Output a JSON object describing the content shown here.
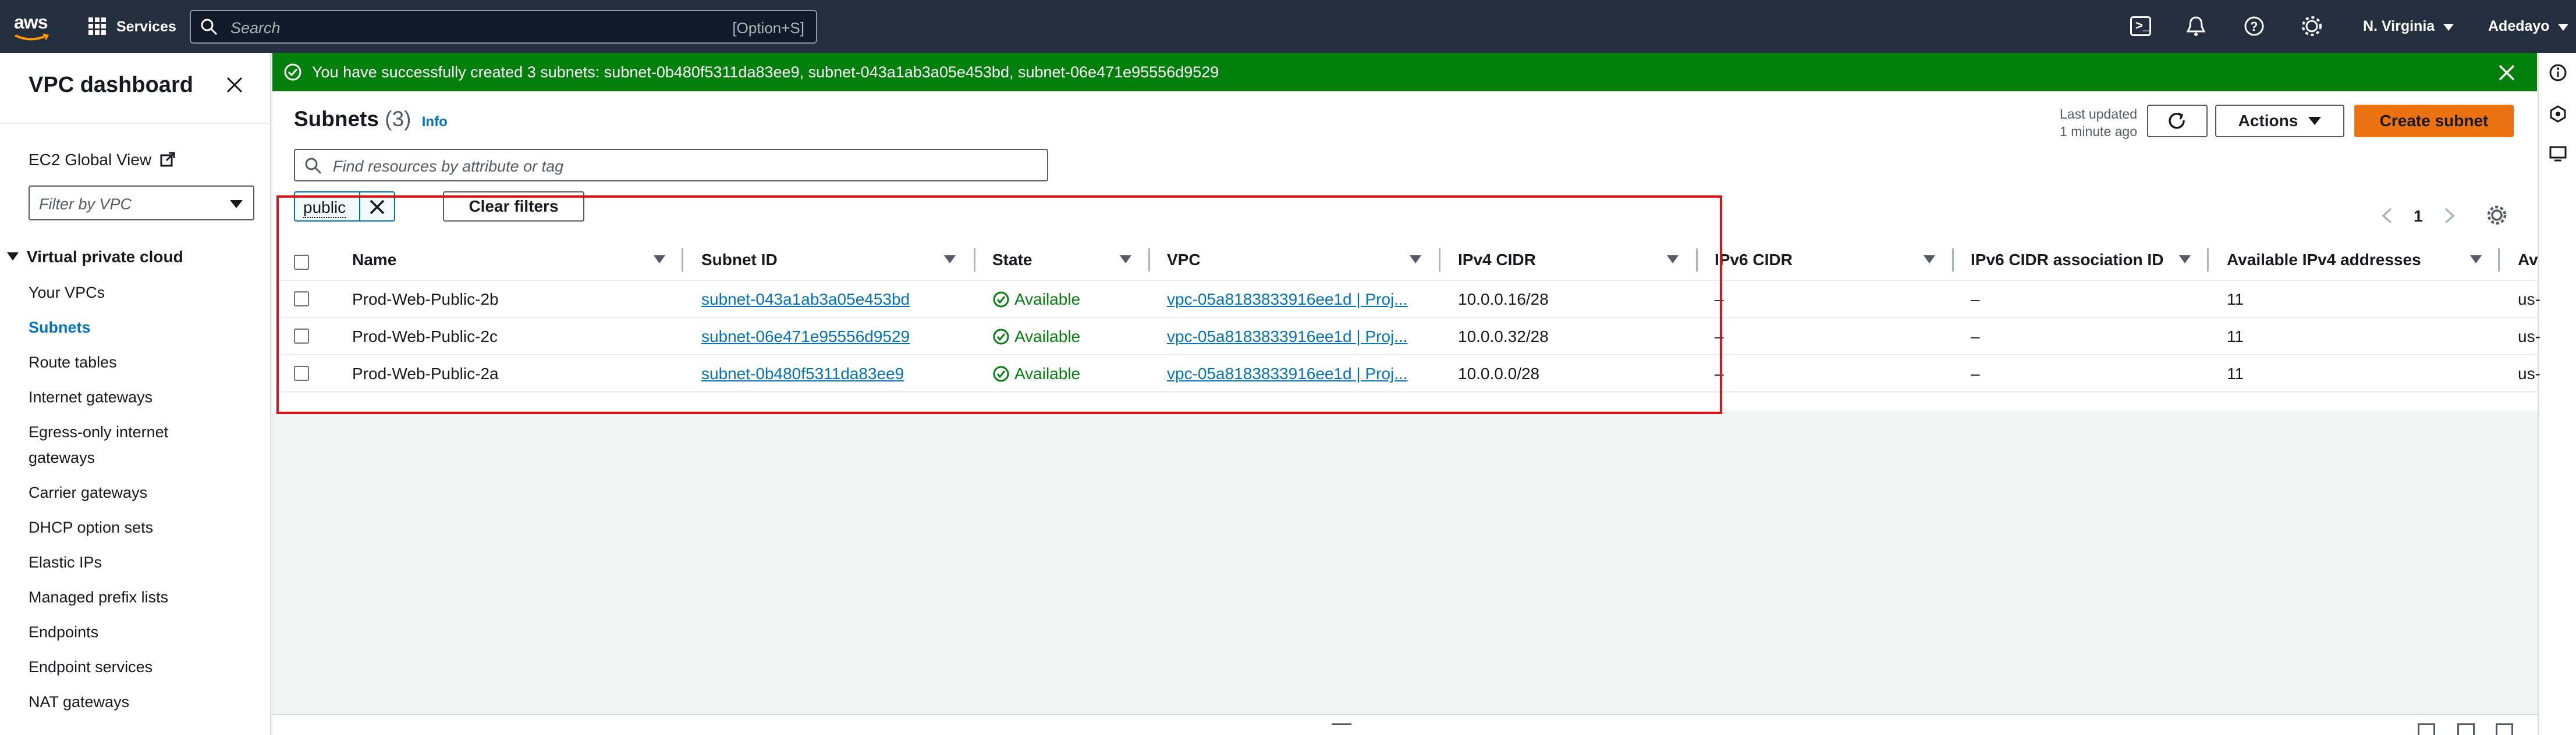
{
  "topnav": {
    "logo": "aws",
    "services_label": "Services",
    "search_placeholder": "Search",
    "search_shortcut": "[Option+S]",
    "region": "N. Virginia",
    "user": "Adedayo"
  },
  "sidebar": {
    "title": "VPC dashboard",
    "ec2_global_view": "EC2 Global View",
    "filter_placeholder": "Filter by VPC",
    "section_title": "Virtual private cloud",
    "items": [
      {
        "label": "Your VPCs"
      },
      {
        "label": "Subnets"
      },
      {
        "label": "Route tables"
      },
      {
        "label": "Internet gateways"
      },
      {
        "label": "Egress-only internet"
      },
      {
        "label": "gateways"
      },
      {
        "label": "Carrier gateways"
      },
      {
        "label": "DHCP option sets"
      },
      {
        "label": "Elastic IPs"
      },
      {
        "label": "Managed prefix lists"
      },
      {
        "label": "Endpoints"
      },
      {
        "label": "Endpoint services"
      },
      {
        "label": "NAT gateways"
      }
    ]
  },
  "flash": {
    "message": "You have successfully created 3 subnets: subnet-0b480f5311da83ee9, subnet-043a1ab3a05e453bd, subnet-06e471e95556d9529"
  },
  "page": {
    "title": "Subnets",
    "count": "(3)",
    "info": "Info",
    "last_updated_line1": "Last updated",
    "last_updated_line2": "1 minute ago",
    "actions_label": "Actions",
    "create_label": "Create subnet",
    "search_placeholder": "Find resources by attribute or tag",
    "filter_token": "public",
    "clear_filters": "Clear filters",
    "page_number": "1"
  },
  "table": {
    "headers": [
      "Name",
      "Subnet ID",
      "State",
      "VPC",
      "IPv4 CIDR",
      "IPv6 CIDR",
      "IPv6 CIDR association ID",
      "Available IPv4 addresses",
      "Av"
    ],
    "rows": [
      {
        "name": "Prod-Web-Public-2b",
        "subnet_id": "subnet-043a1ab3a05e453bd",
        "state": "Available",
        "vpc": "vpc-05a8183833916ee1d | Proj...",
        "ipv4": "10.0.0.16/28",
        "ipv6": "–",
        "ipv6_assoc": "–",
        "avail": "11",
        "az": "us-"
      },
      {
        "name": "Prod-Web-Public-2c",
        "subnet_id": "subnet-06e471e95556d9529",
        "state": "Available",
        "vpc": "vpc-05a8183833916ee1d | Proj...",
        "ipv4": "10.0.0.32/28",
        "ipv6": "–",
        "ipv6_assoc": "–",
        "avail": "11",
        "az": "us-"
      },
      {
        "name": "Prod-Web-Public-2a",
        "subnet_id": "subnet-0b480f5311da83ee9",
        "state": "Available",
        "vpc": "vpc-05a8183833916ee1d | Proj...",
        "ipv4": "10.0.0.0/28",
        "ipv6": "–",
        "ipv6_assoc": "–",
        "avail": "11",
        "az": "us-"
      }
    ]
  },
  "colors": {
    "nav_bg": "#232f3e",
    "success": "#037f0c",
    "primary": "#ec7211",
    "link": "#0073bb",
    "highlight": "#d91515"
  }
}
